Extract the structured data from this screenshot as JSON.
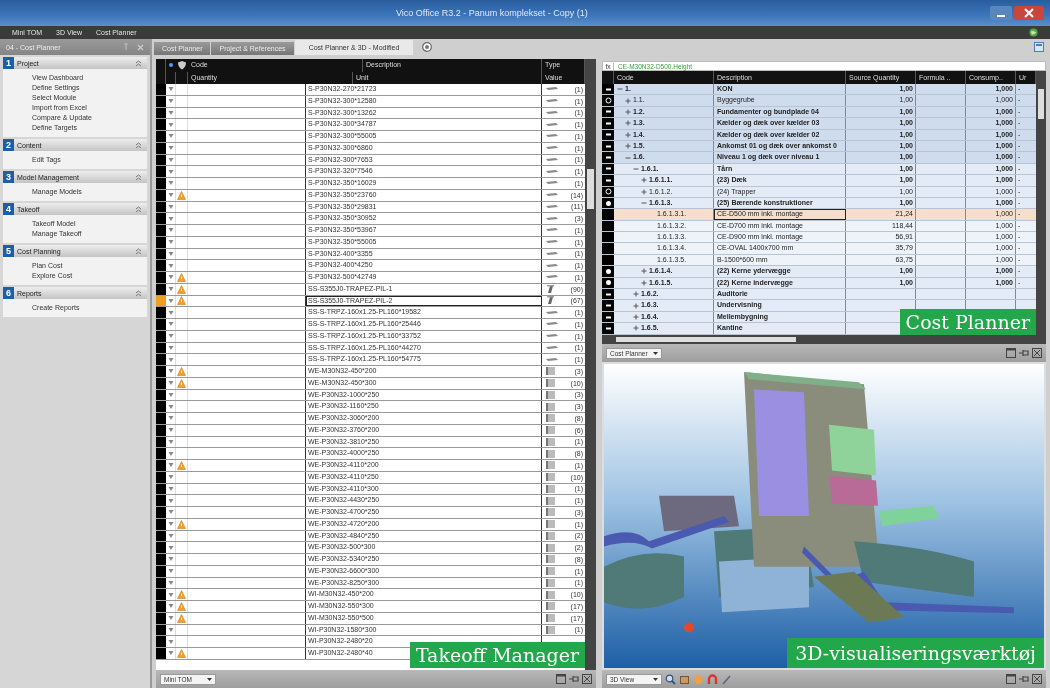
{
  "window": {
    "title": "Vico Office R3.2 - Panum komplekset - Copy (1)"
  },
  "menu": [
    "Mini TOM",
    "3D View",
    "Cost Planner"
  ],
  "sidebar": {
    "title": "04 - Cost Planner",
    "groups": [
      {
        "number": "1",
        "title": "Project",
        "items": [
          "View Dashboard",
          "Define Settings",
          "Select Module",
          "Import from Excel",
          "Compare & Update",
          "Define Targets"
        ]
      },
      {
        "number": "2",
        "title": "Content",
        "items": [
          "Edit Tags"
        ]
      },
      {
        "number": "3",
        "title": "Model Management",
        "items": [
          "Manage Models"
        ]
      },
      {
        "number": "4",
        "title": "Takeoff",
        "items": [
          "Takeoff Model",
          "Manage Takeoff"
        ]
      },
      {
        "number": "5",
        "title": "Cost Planning",
        "items": [
          "Plan Cost",
          "Explore Cost"
        ]
      },
      {
        "number": "6",
        "title": "Reports",
        "items": [
          "Create Reports"
        ]
      }
    ]
  },
  "tabs": [
    {
      "label": "Cost Planner",
      "selected": false
    },
    {
      "label": "Project & References",
      "selected": false
    },
    {
      "label": "Cost Planner & 3D - Modified",
      "selected": true
    }
  ],
  "takeoff": {
    "columns_top": [
      "Code",
      "Description",
      "Type"
    ],
    "columns_bottom": [
      "Quantity",
      "Unit",
      "Value"
    ],
    "rows": [
      {
        "description": "S-P30N32-270*21723",
        "warning": false,
        "kind": "beam",
        "value": "(1)",
        "selected": false
      },
      {
        "description": "S-P30N32-300*12580",
        "warning": false,
        "kind": "beam",
        "value": "(1)",
        "selected": false
      },
      {
        "description": "S-P30N32-300*13262",
        "warning": false,
        "kind": "beam",
        "value": "(1)",
        "selected": false
      },
      {
        "description": "S-P30N32-300*34787",
        "warning": false,
        "kind": "beam",
        "value": "(1)",
        "selected": false
      },
      {
        "description": "S-P30N32-300*55005",
        "warning": false,
        "kind": "beam",
        "value": "(1)",
        "selected": false
      },
      {
        "description": "S-P30N32-300*6860",
        "warning": false,
        "kind": "beam",
        "value": "(1)",
        "selected": false
      },
      {
        "description": "S-P30N32-300*7653",
        "warning": false,
        "kind": "beam",
        "value": "(1)",
        "selected": false
      },
      {
        "description": "S-P30N32-320*7546",
        "warning": false,
        "kind": "beam",
        "value": "(1)",
        "selected": false
      },
      {
        "description": "S-P30N32-350*16029",
        "warning": false,
        "kind": "beam",
        "value": "(1)",
        "selected": false
      },
      {
        "description": "S-P30N32-350*23760",
        "warning": true,
        "kind": "beam",
        "value": "(14)",
        "selected": false
      },
      {
        "description": "S-P30N32-350*29831",
        "warning": false,
        "kind": "beam",
        "value": "(11)",
        "selected": false
      },
      {
        "description": "S-P30N32-350*30952",
        "warning": false,
        "kind": "beam",
        "value": "(3)",
        "selected": false
      },
      {
        "description": "S-P30N32-350*53967",
        "warning": false,
        "kind": "beam",
        "value": "(1)",
        "selected": false
      },
      {
        "description": "S-P30N32-350*55005",
        "warning": false,
        "kind": "beam",
        "value": "(1)",
        "selected": false
      },
      {
        "description": "S-P30N32-400*3355",
        "warning": false,
        "kind": "beam",
        "value": "(1)",
        "selected": false
      },
      {
        "description": "S-P30N32-400*4250",
        "warning": false,
        "kind": "beam",
        "value": "(1)",
        "selected": false
      },
      {
        "description": "S-P30N32-500*42749",
        "warning": true,
        "kind": "beam",
        "value": "(1)",
        "selected": false
      },
      {
        "description": "SS-S355J0-TRAPEZ-PIL-1",
        "warning": true,
        "kind": "column",
        "value": "(90)",
        "selected": false
      },
      {
        "description": "SS-S355J0-TRAPEZ-PIL-2",
        "warning": true,
        "kind": "column",
        "value": "(67)",
        "selected": true
      },
      {
        "description": "SS-S-TRPZ-160x1.25-PL160*19582",
        "warning": false,
        "kind": "beam",
        "value": "(1)",
        "selected": false
      },
      {
        "description": "SS-S-TRPZ-160x1.25-PL160*25446",
        "warning": false,
        "kind": "beam",
        "value": "(1)",
        "selected": false
      },
      {
        "description": "SS-S-TRPZ-160x1.25-PL160*33752",
        "warning": false,
        "kind": "beam",
        "value": "(1)",
        "selected": false
      },
      {
        "description": "SS-S-TRPZ-160x1.25-PL160*44270",
        "warning": false,
        "kind": "beam",
        "value": "(1)",
        "selected": false
      },
      {
        "description": "SS-S-TRPZ-160x1.25-PL160*54775",
        "warning": false,
        "kind": "beam",
        "value": "(1)",
        "selected": false
      },
      {
        "description": "WE-M30N32-450*200",
        "warning": true,
        "kind": "wall",
        "value": "(3)",
        "selected": false
      },
      {
        "description": "WE-M30N32-450*300",
        "warning": true,
        "kind": "wall",
        "value": "(10)",
        "selected": false
      },
      {
        "description": "WE-P30N32-1000*250",
        "warning": false,
        "kind": "wall",
        "value": "(3)",
        "selected": false
      },
      {
        "description": "WE-P30N32-1160*250",
        "warning": false,
        "kind": "wall",
        "value": "(3)",
        "selected": false
      },
      {
        "description": "WE-P30N32-3060*200",
        "warning": false,
        "kind": "wall",
        "value": "(8)",
        "selected": false
      },
      {
        "description": "WE-P30N32-3760*200",
        "warning": false,
        "kind": "wall",
        "value": "(6)",
        "selected": false
      },
      {
        "description": "WE-P30N32-3810*250",
        "warning": false,
        "kind": "wall",
        "value": "(1)",
        "selected": false
      },
      {
        "description": "WE-P30N32-4000*250",
        "warning": false,
        "kind": "wall",
        "value": "(8)",
        "selected": false
      },
      {
        "description": "WE-P30N32-4110*200",
        "warning": true,
        "kind": "wall",
        "value": "(1)",
        "selected": false
      },
      {
        "description": "WE-P30N32-4110*250",
        "warning": false,
        "kind": "wall",
        "value": "(10)",
        "selected": false
      },
      {
        "description": "WE-P30N32-4110*300",
        "warning": false,
        "kind": "wall",
        "value": "(1)",
        "selected": false
      },
      {
        "description": "WE-P30N32-4430*250",
        "warning": false,
        "kind": "wall",
        "value": "(1)",
        "selected": false
      },
      {
        "description": "WE-P30N32-4700*250",
        "warning": false,
        "kind": "wall",
        "value": "(3)",
        "selected": false
      },
      {
        "description": "WE-P30N32-4720*200",
        "warning": true,
        "kind": "wall",
        "value": "(1)",
        "selected": false
      },
      {
        "description": "WE-P30N32-4840*250",
        "warning": false,
        "kind": "wall",
        "value": "(2)",
        "selected": false
      },
      {
        "description": "WE-P30N32-500*300",
        "warning": false,
        "kind": "wall",
        "value": "(2)",
        "selected": false
      },
      {
        "description": "WE-P30N32-5340*250",
        "warning": false,
        "kind": "wall",
        "value": "(8)",
        "selected": false
      },
      {
        "description": "WE-P30N32-6600*300",
        "warning": false,
        "kind": "wall",
        "value": "(1)",
        "selected": false
      },
      {
        "description": "WE-P30N32-8250*300",
        "warning": false,
        "kind": "wall",
        "value": "(1)",
        "selected": false
      },
      {
        "description": "WI-M30N32-450*200",
        "warning": true,
        "kind": "wall",
        "value": "(10)",
        "selected": false
      },
      {
        "description": "WI-M30N32-550*300",
        "warning": true,
        "kind": "wall",
        "value": "(17)",
        "selected": false
      },
      {
        "description": "WI-M30N32-550*500",
        "warning": true,
        "kind": "wall",
        "value": "(17)",
        "selected": false
      },
      {
        "description": "WI-P30N32-1580*300",
        "warning": false,
        "kind": "wall",
        "value": "(1)",
        "selected": false
      },
      {
        "description": "WI-P30N32-2480*20",
        "warning": false,
        "selected": false
      },
      {
        "description": "WI-P30N32-2480*40",
        "warning": true,
        "selected": false
      }
    ],
    "caption": "Takeoff Manager",
    "view_selector": "Mini TOM"
  },
  "cost_planner": {
    "formula_label": "fx",
    "formula": "CE-M30N32-D500.Height",
    "columns": [
      "Code",
      "Description",
      "Source Quantity",
      "Formula ..",
      "Consump..",
      "Ur"
    ],
    "rows": [
      {
        "code": "1.",
        "description": "KON",
        "quantity": "1,00",
        "consumption": "1,000",
        "unit": "-",
        "bold": true,
        "kind": "bar",
        "expanded": true,
        "selected": false,
        "children": [
          {
            "code": "1.1.",
            "description": "Byggegrube",
            "quantity": "1,00",
            "consumption": "1,000",
            "unit": "-",
            "bold": false,
            "kind": "circle",
            "expanded": false,
            "selected": false
          },
          {
            "code": "1.2.",
            "description": "Fundamenter og bundplade 04",
            "quantity": "1,00",
            "consumption": "1,000",
            "unit": "-",
            "bold": true,
            "kind": "bar",
            "expanded": false,
            "selected": false
          },
          {
            "code": "1.3.",
            "description": "Kælder og dæk over kælder 03",
            "quantity": "1,00",
            "consumption": "1,000",
            "unit": "-",
            "bold": true,
            "kind": "bar",
            "expanded": false,
            "selected": false
          },
          {
            "code": "1.4.",
            "description": "Kælder og dæk over kælder 02",
            "quantity": "1,00",
            "consumption": "1,000",
            "unit": "-",
            "bold": true,
            "kind": "bar",
            "expanded": false,
            "selected": false
          },
          {
            "code": "1.5.",
            "description": "Ankomst 01 og dæk over ankomst 0",
            "quantity": "1,00",
            "consumption": "1,000",
            "unit": "-",
            "bold": true,
            "kind": "bar",
            "expanded": false,
            "selected": false
          },
          {
            "code": "1.6.",
            "description": "Niveau 1 og dæk over niveau 1",
            "quantity": "1,00",
            "consumption": "1,000",
            "unit": "-",
            "bold": true,
            "kind": "bar",
            "expanded": true,
            "selected": false,
            "children": [
              {
                "code": "1.6.1.",
                "description": "Tårn",
                "quantity": "1,00",
                "consumption": "1,000",
                "unit": "-",
                "bold": true,
                "kind": "bar",
                "expanded": true,
                "selected": false,
                "children": [
                  {
                    "code": "1.6.1.1.",
                    "description": "(23) Dæk",
                    "quantity": "1,00",
                    "consumption": "1,000",
                    "unit": "-",
                    "bold": true,
                    "kind": "bar",
                    "expanded": false,
                    "selected": false
                  },
                  {
                    "code": "1.6.1.2.",
                    "description": "(24) Trapper",
                    "quantity": "1,00",
                    "consumption": "1,000",
                    "unit": "-",
                    "bold": false,
                    "kind": "circle",
                    "expanded": false,
                    "selected": false
                  },
                  {
                    "code": "1.6.1.3.",
                    "description": "(25) Bærende konstruktioner",
                    "quantity": "1,00",
                    "consumption": "1,000",
                    "unit": "-",
                    "bold": true,
                    "kind": "dot",
                    "expanded": true,
                    "selected": false,
                    "children": [
                      {
                        "code": "1.6.1.3.1.",
                        "description": "CE-D500 mm inkl. montage",
                        "quantity": "21,24",
                        "consumption": "1,000",
                        "unit": "-",
                        "bold": false,
                        "selected": true
                      },
                      {
                        "code": "1.6.1.3.2.",
                        "description": "CE-D700 mm inkl. montage",
                        "quantity": "118,44",
                        "consumption": "1,000",
                        "unit": "-",
                        "bold": false,
                        "selected": false
                      },
                      {
                        "code": "1.6.1.3.3.",
                        "description": "CE-D900 mm inkl. montage",
                        "quantity": "56,91",
                        "consumption": "1,000",
                        "unit": "-",
                        "bold": false,
                        "selected": false
                      },
                      {
                        "code": "1.6.1.3.4.",
                        "description": "CE-OVAL 1400x700 mm",
                        "quantity": "35,79",
                        "consumption": "1,000",
                        "unit": "-",
                        "bold": false,
                        "selected": false
                      },
                      {
                        "code": "1.6.1.3.5.",
                        "description": "B-1500*600 mm",
                        "quantity": "63,75",
                        "consumption": "1,000",
                        "unit": "-",
                        "bold": false,
                        "selected": false
                      }
                    ]
                  },
                  {
                    "code": "1.6.1.4.",
                    "description": "(22) Kerne ydervægge",
                    "quantity": "1,00",
                    "consumption": "1,000",
                    "unit": "-",
                    "bold": true,
                    "kind": "dot",
                    "expanded": false,
                    "selected": false
                  },
                  {
                    "code": "1.6.1.5.",
                    "description": "(22) Kerne indervægge",
                    "quantity": "1,00",
                    "consumption": "1,000",
                    "unit": "-",
                    "bold": true,
                    "kind": "dot",
                    "expanded": false,
                    "selected": false
                  }
                ]
              },
              {
                "code": "1.6.2.",
                "description": "Auditorie",
                "bold": true,
                "kind": "bar",
                "expanded": false,
                "selected": false
              },
              {
                "code": "1.6.3.",
                "description": "Undervisning",
                "bold": true,
                "kind": "bar",
                "expanded": false,
                "selected": false
              },
              {
                "code": "1.6.4.",
                "description": "Mellembygning",
                "bold": true,
                "kind": "bar",
                "expanded": false,
                "selected": false
              },
              {
                "code": "1.6.5.",
                "description": "Kantine",
                "bold": true,
                "kind": "bar",
                "expanded": false,
                "selected": false
              }
            ]
          }
        ]
      }
    ],
    "caption": "Cost Planner",
    "view_selector": "Cost Planner"
  },
  "viewer": {
    "caption": "3D-visualiseringsværktøj",
    "view_selector": "3D View"
  }
}
